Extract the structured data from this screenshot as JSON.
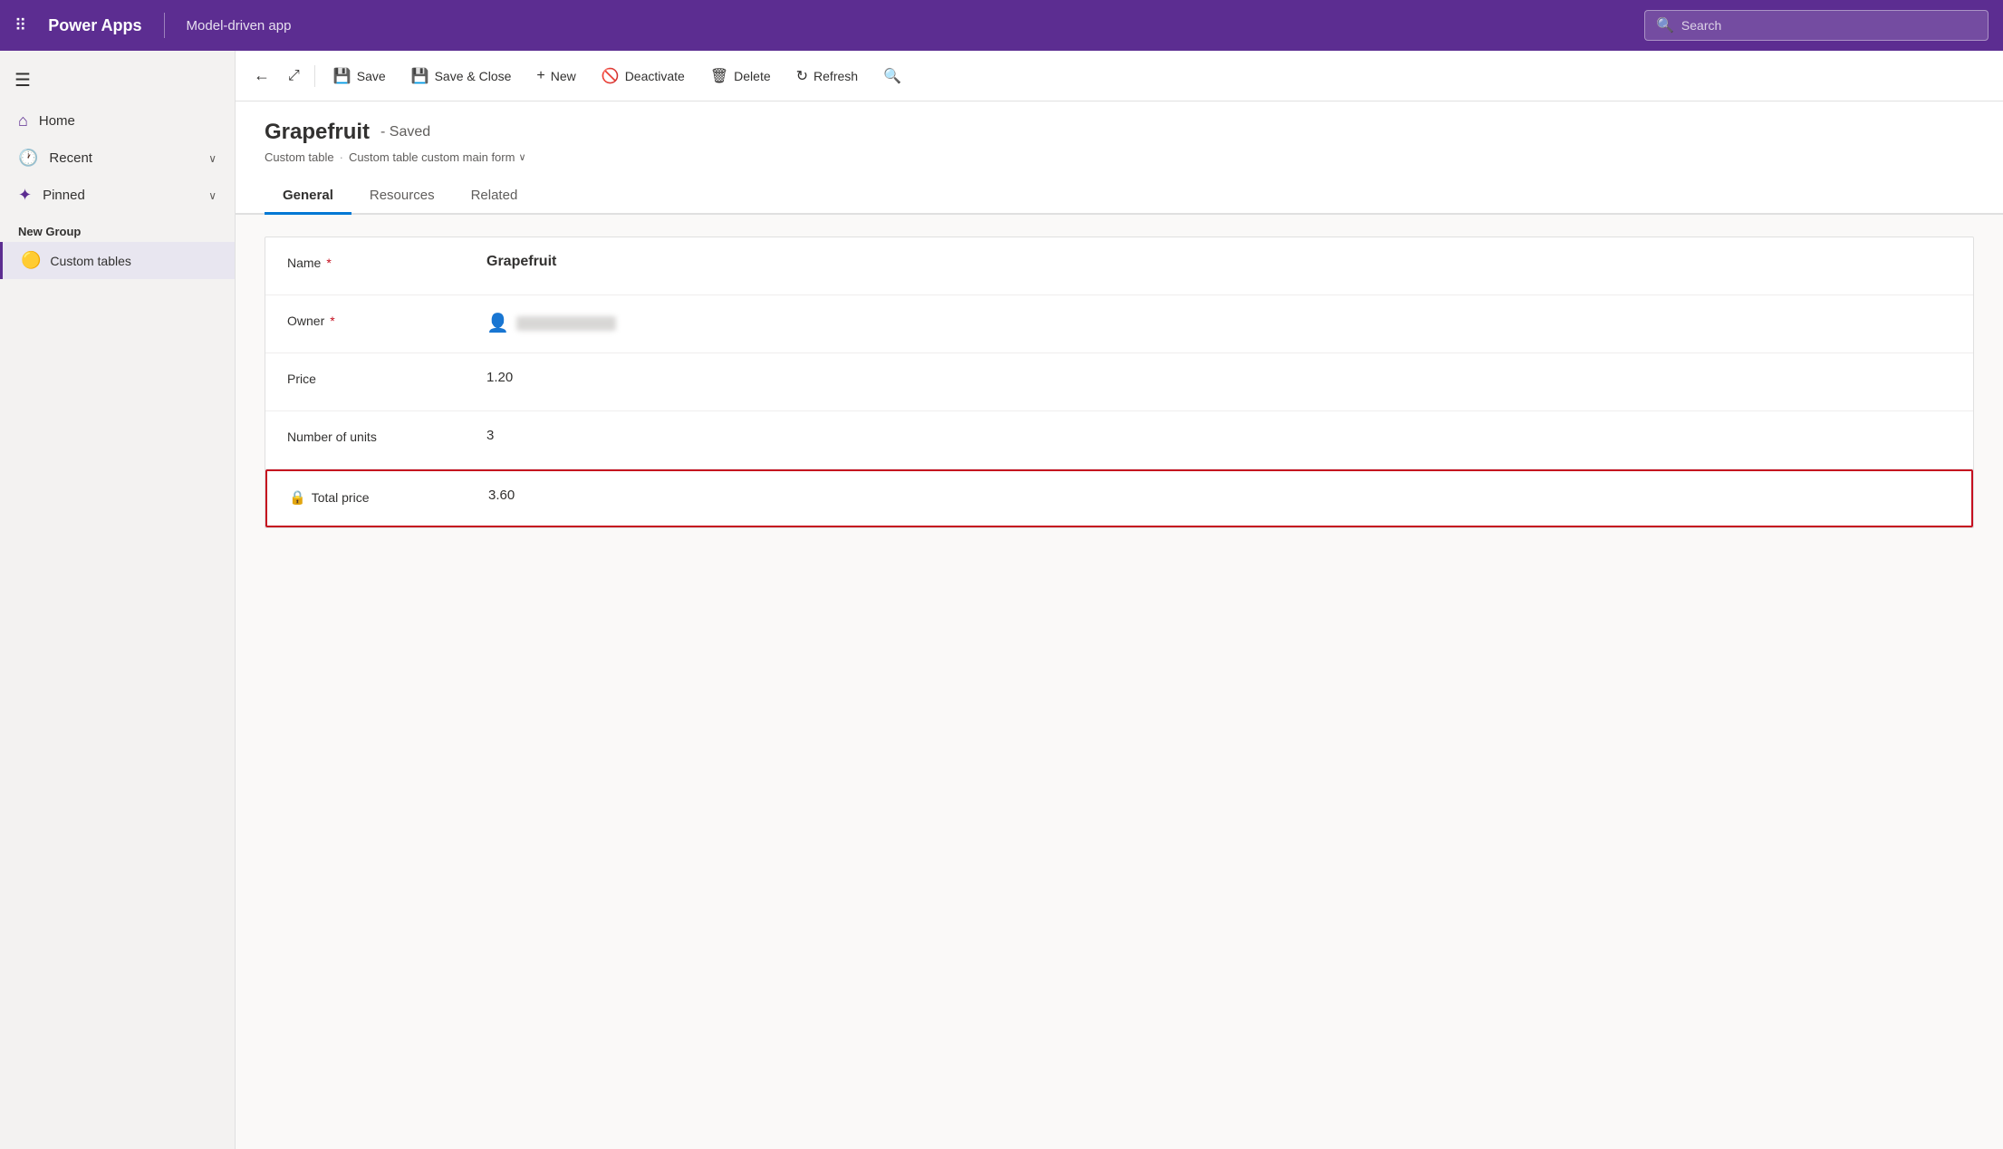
{
  "topbar": {
    "waffle_icon": "⊞",
    "app_name": "Power Apps",
    "app_subtitle": "Model-driven app",
    "search_placeholder": "Search"
  },
  "commands": {
    "back_icon": "←",
    "share_icon": "⤢",
    "save_label": "Save",
    "save_close_label": "Save & Close",
    "new_label": "New",
    "deactivate_label": "Deactivate",
    "delete_label": "Delete",
    "refresh_label": "Refresh",
    "search_icon": "🔍"
  },
  "sidebar": {
    "hamburger": "☰",
    "home_label": "Home",
    "recent_label": "Recent",
    "pinned_label": "Pinned",
    "new_group_label": "New Group",
    "custom_tables_label": "Custom tables",
    "custom_tables_emoji": "🟡"
  },
  "record": {
    "title": "Grapefruit",
    "saved_status": "- Saved",
    "breadcrumb_table": "Custom table",
    "breadcrumb_form": "Custom table custom main form",
    "breadcrumb_sep": "·"
  },
  "tabs": [
    {
      "label": "General",
      "active": true
    },
    {
      "label": "Resources",
      "active": false
    },
    {
      "label": "Related",
      "active": false
    }
  ],
  "form": {
    "fields": [
      {
        "label": "Name",
        "required": true,
        "value": "Grapefruit",
        "type": "text",
        "bold": true
      },
      {
        "label": "Owner",
        "required": true,
        "value": "",
        "type": "owner"
      },
      {
        "label": "Price",
        "required": false,
        "value": "1.20",
        "type": "text"
      },
      {
        "label": "Number of units",
        "required": false,
        "value": "3",
        "type": "text"
      },
      {
        "label": "Total price",
        "required": false,
        "value": "3.60",
        "type": "locked",
        "highlighted": true
      }
    ]
  },
  "icons": {
    "home": "⌂",
    "recent": "🕐",
    "pinned": "✦",
    "save": "💾",
    "save_close": "💾",
    "new": "+",
    "deactivate": "🚫",
    "delete": "🗑",
    "refresh": "↻",
    "search": "🔍",
    "user": "👤",
    "lock": "🔒",
    "chevron_down": "∨",
    "back": "←",
    "share": "⤢"
  }
}
